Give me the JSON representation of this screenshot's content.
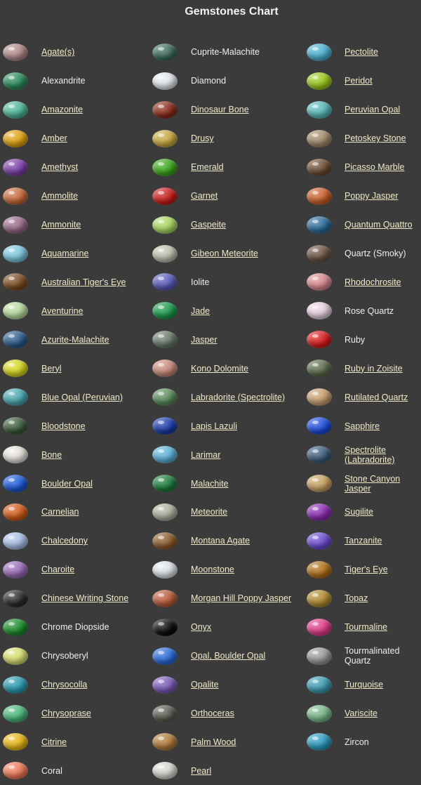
{
  "title": "Gemstones Chart",
  "columns": [
    [
      {
        "name": "Agate(s)",
        "link": true,
        "color": "#b08a8a",
        "icon": "agate-stone"
      },
      {
        "name": "Alexandrite",
        "link": false,
        "color": "#2a8a5a",
        "icon": "alexandrite-stone"
      },
      {
        "name": "Amazonite",
        "link": true,
        "color": "#4fb89a",
        "icon": "amazonite-stone"
      },
      {
        "name": "Amber",
        "link": true,
        "color": "#e0a410",
        "icon": "amber-stone"
      },
      {
        "name": "Amethyst",
        "link": true,
        "color": "#7a3fa8",
        "icon": "amethyst-stone"
      },
      {
        "name": "Ammolite",
        "link": true,
        "color": "#c86a3a",
        "icon": "ammolite-stone"
      },
      {
        "name": "Ammonite",
        "link": true,
        "color": "#9a6a8a",
        "icon": "ammonite-stone"
      },
      {
        "name": "Aquamarine",
        "link": true,
        "color": "#7cc8e0",
        "icon": "aquamarine-stone"
      },
      {
        "name": "Australian Tiger's Eye",
        "link": true,
        "color": "#7a4a20",
        "icon": "australian-tigers-eye-stone"
      },
      {
        "name": "Aventurine",
        "link": true,
        "color": "#b8dca0",
        "icon": "aventurine-stone"
      },
      {
        "name": "Azurite-Malachite",
        "link": true,
        "color": "#2a5a8a",
        "icon": "azurite-malachite-stone"
      },
      {
        "name": "Beryl",
        "link": true,
        "color": "#d8d820",
        "icon": "beryl-stone"
      },
      {
        "name": "Blue Opal (Peruvian)",
        "link": true,
        "color": "#4aa8b0",
        "icon": "blue-opal-stone"
      },
      {
        "name": "Bloodstone",
        "link": true,
        "color": "#3a5a3a",
        "icon": "bloodstone-stone"
      },
      {
        "name": "Bone",
        "link": true,
        "color": "#e8e4dc",
        "icon": "bone-stone"
      },
      {
        "name": "Boulder Opal",
        "link": true,
        "color": "#1a5ad8",
        "icon": "boulder-opal-stone"
      },
      {
        "name": "Carnelian",
        "link": true,
        "color": "#d25a1a",
        "icon": "carnelian-stone"
      },
      {
        "name": "Chalcedony",
        "link": true,
        "color": "#aac0e8",
        "icon": "chalcedony-stone"
      },
      {
        "name": "Charoite",
        "link": true,
        "color": "#9a6ab8",
        "icon": "charoite-stone"
      },
      {
        "name": "Chinese Writing Stone",
        "link": true,
        "color": "#2a2a2a",
        "icon": "chinese-writing-stone"
      },
      {
        "name": "Chrome Diopside",
        "link": false,
        "color": "#1a8a2a",
        "icon": "chrome-diopside-stone"
      },
      {
        "name": "Chrysoberyl",
        "link": false,
        "color": "#d8e070",
        "icon": "chrysoberyl-stone"
      },
      {
        "name": "Chrysocolla",
        "link": true,
        "color": "#2a9ab0",
        "icon": "chrysocolla-stone"
      },
      {
        "name": "Chrysoprase",
        "link": true,
        "color": "#4ab87a",
        "icon": "chrysoprase-stone"
      },
      {
        "name": "Citrine",
        "link": true,
        "color": "#e8b81a",
        "icon": "citrine-stone"
      },
      {
        "name": "Coral",
        "link": false,
        "color": "#f07a5a",
        "icon": "coral-stone"
      }
    ],
    [
      {
        "name": "Cuprite-Malachite",
        "link": false,
        "color": "#3a6a5a",
        "icon": "cuprite-malachite-stone"
      },
      {
        "name": "Diamond",
        "link": false,
        "color": "#e4e8ee",
        "icon": "diamond-stone"
      },
      {
        "name": "Dinosaur Bone",
        "link": true,
        "color": "#8a2a1a",
        "icon": "dinosaur-bone-stone"
      },
      {
        "name": "Drusy",
        "link": true,
        "color": "#c8a840",
        "icon": "drusy-stone"
      },
      {
        "name": "Emerald",
        "link": true,
        "color": "#3aa81a",
        "icon": "emerald-stone"
      },
      {
        "name": "Garnet",
        "link": true,
        "color": "#c81a1a",
        "icon": "garnet-stone"
      },
      {
        "name": "Gaspeite",
        "link": true,
        "color": "#a8d860",
        "icon": "gaspeite-stone"
      },
      {
        "name": "Gibeon Meteorite",
        "link": true,
        "color": "#c0c0b0",
        "icon": "gibeon-meteorite-stone"
      },
      {
        "name": "Iolite",
        "link": false,
        "color": "#5a5ab8",
        "icon": "iolite-stone"
      },
      {
        "name": "Jade",
        "link": true,
        "color": "#1a9a4a",
        "icon": "jade-stone"
      },
      {
        "name": "Jasper",
        "link": true,
        "color": "#6a7a6a",
        "icon": "jasper-stone"
      },
      {
        "name": "Kono Dolomite",
        "link": true,
        "color": "#c88a7a",
        "icon": "kono-dolomite-stone"
      },
      {
        "name": "Labradorite (Spectrolite)",
        "link": true,
        "color": "#5a8a5a",
        "icon": "labradorite-stone"
      },
      {
        "name": "Lapis Lazuli",
        "link": true,
        "color": "#1a3aa8",
        "icon": "lapis-lazuli-stone"
      },
      {
        "name": "Larimar",
        "link": true,
        "color": "#5ab0d8",
        "icon": "larimar-stone"
      },
      {
        "name": "Malachite",
        "link": true,
        "color": "#1a7a3a",
        "icon": "malachite-stone"
      },
      {
        "name": "Meteorite",
        "link": true,
        "color": "#b0b0a0",
        "icon": "meteorite-stone"
      },
      {
        "name": "Montana Agate",
        "link": true,
        "color": "#8a5a2a",
        "icon": "montana-agate-stone"
      },
      {
        "name": "Moonstone",
        "link": true,
        "color": "#e0e4ea",
        "icon": "moonstone-stone"
      },
      {
        "name": "Morgan Hill Poppy Jasper",
        "link": true,
        "color": "#b85a3a",
        "icon": "morgan-hill-poppy-jasper-stone"
      },
      {
        "name": "Onyx",
        "link": true,
        "color": "#0a0a0a",
        "icon": "onyx-stone"
      },
      {
        "name": "Opal, Boulder Opal",
        "link": true,
        "color": "#2a6ad8",
        "icon": "opal-boulder-opal-stone"
      },
      {
        "name": "Opalite",
        "link": true,
        "color": "#7a5ab8",
        "icon": "opalite-stone"
      },
      {
        "name": "Orthoceras",
        "link": true,
        "color": "#5a5a50",
        "icon": "orthoceras-stone"
      },
      {
        "name": "Palm Wood",
        "link": true,
        "color": "#b07a3a",
        "icon": "palm-wood-stone"
      },
      {
        "name": "Pearl",
        "link": true,
        "color": "#d8d8d0",
        "icon": "pearl-stone"
      }
    ],
    [
      {
        "name": "Pectolite",
        "link": true,
        "color": "#4ab0d0",
        "icon": "pectolite-stone"
      },
      {
        "name": "Peridot",
        "link": true,
        "color": "#9ac81a",
        "icon": "peridot-stone"
      },
      {
        "name": "Peruvian Opal",
        "link": true,
        "color": "#5ab8b8",
        "icon": "peruvian-opal-stone"
      },
      {
        "name": "Petoskey Stone",
        "link": true,
        "color": "#a08a6a",
        "icon": "petoskey-stone"
      },
      {
        "name": "Picasso Marble",
        "link": true,
        "color": "#6a4a30",
        "icon": "picasso-marble-stone"
      },
      {
        "name": "Poppy Jasper",
        "link": true,
        "color": "#c8602a",
        "icon": "poppy-jasper-stone"
      },
      {
        "name": "Quantum Quattro",
        "link": true,
        "color": "#2a6a9a",
        "icon": "quantum-quattro-stone"
      },
      {
        "name": "Quartz (Smoky)",
        "link": false,
        "color": "#6a5040",
        "icon": "smoky-quartz-stone"
      },
      {
        "name": "Rhodochrosite",
        "link": true,
        "color": "#d88a90",
        "icon": "rhodochrosite-stone"
      },
      {
        "name": "Rose Quartz",
        "link": false,
        "color": "#e8d0e0",
        "icon": "rose-quartz-stone"
      },
      {
        "name": "Ruby",
        "link": false,
        "color": "#d81a1a",
        "icon": "ruby-stone"
      },
      {
        "name": "Ruby in Zoisite",
        "link": true,
        "color": "#5a6a4a",
        "icon": "ruby-in-zoisite-stone"
      },
      {
        "name": "Rutilated Quartz",
        "link": true,
        "color": "#c8a070",
        "icon": "rutilated-quartz-stone"
      },
      {
        "name": "Sapphire",
        "link": true,
        "color": "#1a4ad8",
        "icon": "sapphire-stone"
      },
      {
        "name": "Spectrolite (Labradorite)",
        "link": true,
        "color": "#3a5a7a",
        "icon": "spectrolite-stone"
      },
      {
        "name": "Stone Canyon Jasper",
        "link": true,
        "color": "#c8a060",
        "icon": "stone-canyon-jasper-stone"
      },
      {
        "name": "Sugilite",
        "link": true,
        "color": "#8a2ab0",
        "icon": "sugilite-stone"
      },
      {
        "name": "Tanzanite",
        "link": true,
        "color": "#6a4ad0",
        "icon": "tanzanite-stone"
      },
      {
        "name": "Tiger's Eye",
        "link": true,
        "color": "#b0701a",
        "icon": "tigers-eye-stone"
      },
      {
        "name": "Topaz",
        "link": true,
        "color": "#b08a30",
        "icon": "topaz-stone"
      },
      {
        "name": "Tourmaline",
        "link": true,
        "color": "#e03a8a",
        "icon": "tourmaline-stone"
      },
      {
        "name": "Tourmalinated Quartz",
        "link": false,
        "color": "#9a9a9a",
        "icon": "tourmalinated-quartz-stone"
      },
      {
        "name": "Turquoise",
        "link": true,
        "color": "#3a9ab0",
        "icon": "turquoise-stone"
      },
      {
        "name": "Variscite",
        "link": true,
        "color": "#7ab88a",
        "icon": "variscite-stone"
      },
      {
        "name": "Zircon",
        "link": false,
        "color": "#2a9ac0",
        "icon": "zircon-stone"
      }
    ]
  ]
}
